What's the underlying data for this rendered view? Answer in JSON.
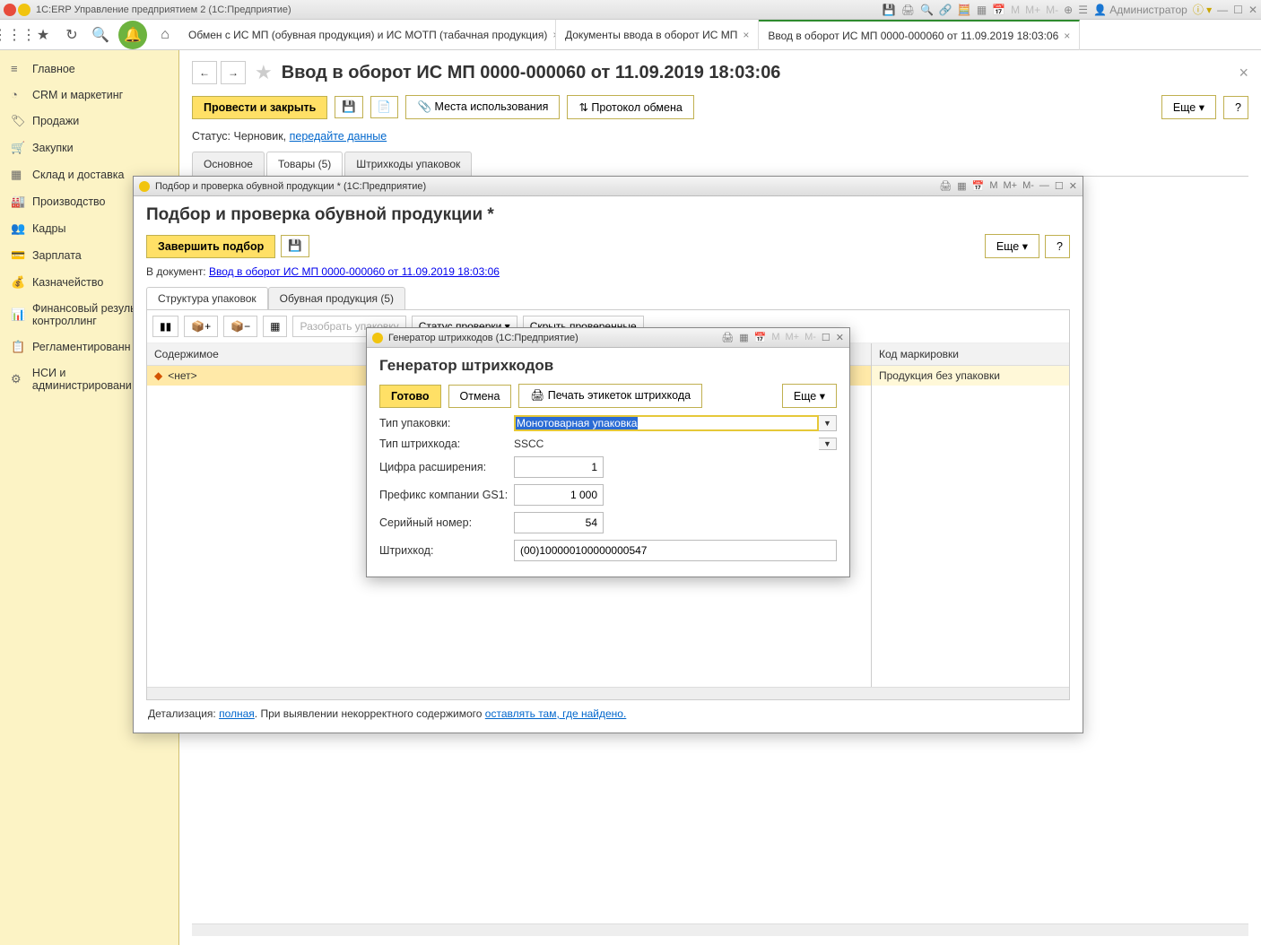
{
  "app": {
    "title": "1С:ERP Управление предприятием 2  (1С:Предприятие)",
    "user_label": "Администратор"
  },
  "tabs": [
    {
      "label": "Обмен с ИС МП (обувная продукция) и ИС МОТП (табачная продукция)"
    },
    {
      "label": "Документы ввода в оборот ИС МП"
    },
    {
      "label": "Ввод в оборот ИС МП 0000-000060 от 11.09.2019 18:03:06"
    }
  ],
  "sidebar": [
    {
      "label": "Главное"
    },
    {
      "label": "CRM и маркетинг"
    },
    {
      "label": "Продажи"
    },
    {
      "label": "Закупки"
    },
    {
      "label": "Склад и доставка"
    },
    {
      "label": "Производство"
    },
    {
      "label": "Кадры"
    },
    {
      "label": "Зарплата"
    },
    {
      "label": "Казначейство"
    },
    {
      "label": "Финансовый результат и контроллинг"
    },
    {
      "label": "Регламентированн"
    },
    {
      "label": "НСИ и администрировани"
    }
  ],
  "page": {
    "title": "Ввод в оборот ИС МП 0000-000060 от 11.09.2019 18:03:06",
    "post_close": "Провести и закрыть",
    "usage": "Места использования",
    "exchange": "Протокол обмена",
    "more": "Еще",
    "help": "?",
    "status_label": "Статус:",
    "status_value": "Черновик,",
    "status_link": "передайте данные",
    "doc_tabs": [
      "Основное",
      "Товары (5)",
      "Штрихкоды упаковок"
    ]
  },
  "modal_pick": {
    "win_title": "Подбор и проверка обувной продукции *  (1С:Предприятие)",
    "h1": "Подбор и проверка обувной продукции *",
    "finish": "Завершить подбор",
    "more": "Еще",
    "help": "?",
    "to_doc_label": "В документ:",
    "to_doc_link": "Ввод в оборот ИС МП 0000-000060 от 11.09.2019 18:03:06",
    "tabs": [
      "Структура упаковок",
      "Обувная продукция (5)"
    ],
    "tb_disassemble": "Разобрать упаковку",
    "tb_status": "Статус проверки",
    "tb_hide": "Скрыть проверенные",
    "col_content": "Содержимое",
    "col_code": "Код маркировки",
    "row_none": "<нет>",
    "row_right": "Продукция без упаковки",
    "detail_prefix": "Детализация:",
    "detail_link1": "полная",
    "detail_mid": ". При выявлении некорректного содержимого ",
    "detail_link2": "оставлять там, где найдено."
  },
  "modal_gen": {
    "win_title": "Генератор штрихкодов  (1С:Предприятие)",
    "h1": "Генератор штрихкодов",
    "done": "Готово",
    "cancel": "Отмена",
    "print": "Печать этикеток штрихкода",
    "more": "Еще",
    "f_pack_type": "Тип упаковки:",
    "v_pack_type": "Монотоварная упаковка",
    "f_bc_type": "Тип штрихкода:",
    "v_bc_type": "SSCC",
    "f_ext": "Цифра расширения:",
    "v_ext": "1",
    "f_gs1": "Префикс компании GS1:",
    "v_gs1": "1 000",
    "f_serial": "Серийный номер:",
    "v_serial": "54",
    "f_bc": "Штрихкод:",
    "v_bc": "(00)100000100000000547"
  }
}
